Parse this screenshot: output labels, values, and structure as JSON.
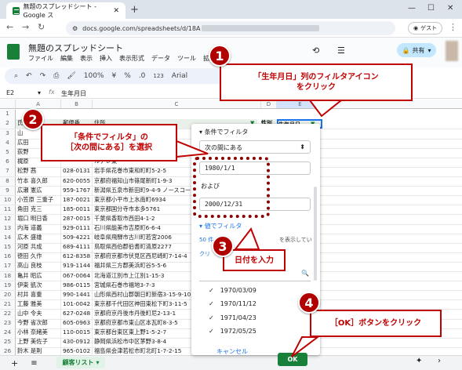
{
  "browser": {
    "tab_title": "無題のスプレッドシート - Google ス",
    "new_tab": "+",
    "address": "docs.google.com/spreadsheets/d/18A",
    "guest": "ゲスト",
    "min": "—",
    "max": "☐",
    "close": "✕"
  },
  "sheets": {
    "doc_title": "無題のスプレッドシート",
    "menus": [
      "ファイル",
      "編集",
      "表示",
      "挿入",
      "表示形式",
      "データ",
      "ツール",
      "拡張"
    ],
    "zoom": "100%",
    "font": "Arial",
    "share": "共有",
    "cell_ref": "E2",
    "formula": "生年月日"
  },
  "grid": {
    "columns": [
      "",
      "A",
      "B",
      "C",
      "D",
      "E"
    ],
    "header_row": {
      "num": "2",
      "name": "氏名",
      "zip": "郵便番",
      "addr": "住所",
      "d": "性別",
      "e": "生年月日"
    },
    "rows": [
      {
        "n": "3",
        "name": "山",
        "zip": "",
        "addr": ""
      },
      {
        "n": "4",
        "name": "広田",
        "zip": "",
        "addr": ""
      },
      {
        "n": "5",
        "name": "荻野",
        "zip": "",
        "addr": ""
      },
      {
        "n": "6",
        "name": "梶原",
        "zip": "",
        "addr": "ルアレ東"
      },
      {
        "n": "7",
        "name": "松野 茜",
        "zip": "028-0131",
        "addr": "岩手県花巻市東和町町5-2-5"
      },
      {
        "n": "8",
        "name": "竹本 喜久郎",
        "zip": "620-0055",
        "addr": "京都府福知山市篠尾新町1-9-3"
      },
      {
        "n": "9",
        "name": "広瀬 憲広",
        "zip": "959-1767",
        "addr": "新潟県五泉市新田町9-4-9 ノースコー"
      },
      {
        "n": "10",
        "name": "小笠原 三重子",
        "zip": "187-0021",
        "addr": "東京都小平市上水南町6934"
      },
      {
        "n": "11",
        "name": "角田 克三",
        "zip": "185-0011",
        "addr": "東京都国分寺市本多5761"
      },
      {
        "n": "12",
        "name": "堀口 明日香",
        "zip": "287-0015",
        "addr": "千葉県香取市西田4-1-2"
      },
      {
        "n": "13",
        "name": "内海 道義",
        "zip": "929-0111",
        "addr": "石川県能美市吉原町6-6-4"
      },
      {
        "n": "14",
        "name": "広木 盛雄",
        "zip": "509-4221",
        "addr": "岐阜県飛騨市古川町若宮2006"
      },
      {
        "n": "15",
        "name": "河原 共成",
        "zip": "689-4111",
        "addr": "鳥取県西伯郡伯耆町清原2277"
      },
      {
        "n": "16",
        "name": "徳田 久作",
        "zip": "612-8358",
        "addr": "京都府京都市伏見区西尼崎町7-14-4"
      },
      {
        "n": "17",
        "name": "高山 良枝",
        "zip": "919-1144",
        "addr": "福井県三方郡美浜町谷5-5-6"
      },
      {
        "n": "18",
        "name": "亀井 昭広",
        "zip": "067-0064",
        "addr": "北海道江別市上江別1-15-3"
      },
      {
        "n": "19",
        "name": "伊東 凱次",
        "zip": "986-0115",
        "addr": "宮城県石巻市福地3-7-3"
      },
      {
        "n": "20",
        "name": "村井 喜重",
        "zip": "990-1441",
        "addr": "山形県西村山郡朝日町新宿3-15-9-10"
      },
      {
        "n": "21",
        "name": "工藤 雅美",
        "zip": "101-0042",
        "addr": "東京都千代田区神田東松下町3-11-5"
      },
      {
        "n": "22",
        "name": "山中 令夫",
        "zip": "627-0248",
        "addr": "京都府京丹後市丹後町尼2-13-1"
      },
      {
        "n": "23",
        "name": "今野 省次郎",
        "zip": "605-0963",
        "addr": "京都府京都市東山区本瓦町8-3-5"
      },
      {
        "n": "24",
        "name": "小林 奈緒美",
        "zip": "110-0015",
        "addr": "東京都台東区東上野1-5-2-7"
      },
      {
        "n": "25",
        "name": "上野 美佐子",
        "zip": "430-0912",
        "addr": "静岡県浜松市中区茅野3-8-4"
      },
      {
        "n": "26",
        "name": "鈴木 是則",
        "zip": "965-0102",
        "addr": "福島県会津若松市町北町1-7-2-15"
      }
    ]
  },
  "sheet_tab": "顧客リスト",
  "filter_panel": {
    "condition_header": "条件でフィルタ",
    "condition_value": "次の間にある",
    "from": "1980/1/1",
    "and": "および",
    "to": "2000/12/31",
    "value_header": "値でフィルタ",
    "select_all_partial": "50 件",
    "show_partial": "を表示してい",
    "clear_partial": "クリ",
    "values": [
      "1970/03/09",
      "1970/11/12",
      "1971/04/23",
      "1972/05/25"
    ],
    "cancel": "キャンセル",
    "ok": "OK"
  },
  "callouts": [
    {
      "num": "1",
      "text": "「生年月日」列のフィルタアイコン\nをクリック"
    },
    {
      "num": "2",
      "text": "「条件でフィルタ」の\n［次の間にある］を選択"
    },
    {
      "num": "3",
      "text": "日付を入力"
    },
    {
      "num": "4",
      "text": "［OK］ボタンをクリック"
    }
  ],
  "colors": {
    "callout": "#c00000",
    "number_badge": "#b00000",
    "sheets_green": "#188038"
  }
}
